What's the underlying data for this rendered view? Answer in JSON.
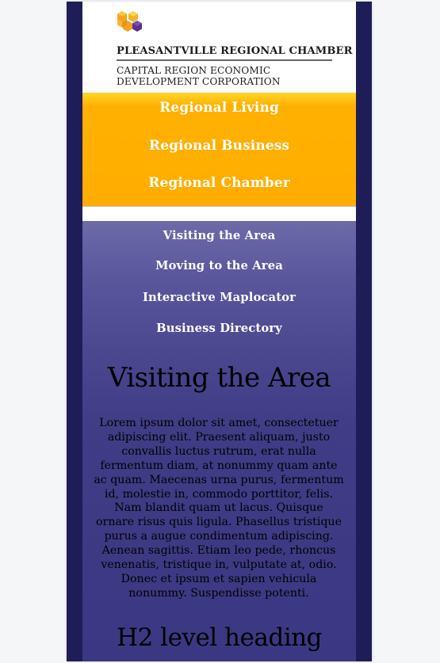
{
  "header": {
    "org_name": "PLEASANTVILLE REGIONAL CHAMBER",
    "subtitle_line1": "CAPITAL REGION ECONOMIC",
    "subtitle_line2": "DEVELOPMENT CORPORATION",
    "logo_colors": [
      "#f4a31c",
      "#f0b428",
      "#5d2f91",
      "#ffffff"
    ]
  },
  "primary_nav": {
    "items": [
      {
        "label": "Regional Living"
      },
      {
        "label": "Regional Business"
      },
      {
        "label": "Regional Chamber"
      }
    ]
  },
  "secondary_nav": {
    "items": [
      {
        "label": "Visiting the Area"
      },
      {
        "label": "Moving to the Area"
      },
      {
        "label": "Interactive Maplocator"
      },
      {
        "label": "Business Directory"
      }
    ]
  },
  "main": {
    "title": "Visiting the Area",
    "body": "Lorem ipsum dolor sit amet, consectetuer adipiscing elit. Praesent aliquam, justo convallis luctus rutrum, erat nulla fermentum diam, at nonummy quam ante ac quam. Maecenas urna purus, fermentum id, molestie in, commodo porttitor, felis. Nam blandit quam ut lacus. Quisque ornare risus quis ligula. Phasellus tristique purus a augue condimentum adipiscing. Aenean sagittis. Etiam leo pede, rhoncus venenatis, tristique in, vulputate at, odio. Donec et ipsum et sapien vehicula nonummy. Suspendisse potenti.",
    "subheading": "H2 level heading"
  },
  "theme": {
    "navy": "#1f1d58",
    "content_purple": "#3f3d86",
    "gold": "#ffae00",
    "white": "#ffffff"
  }
}
